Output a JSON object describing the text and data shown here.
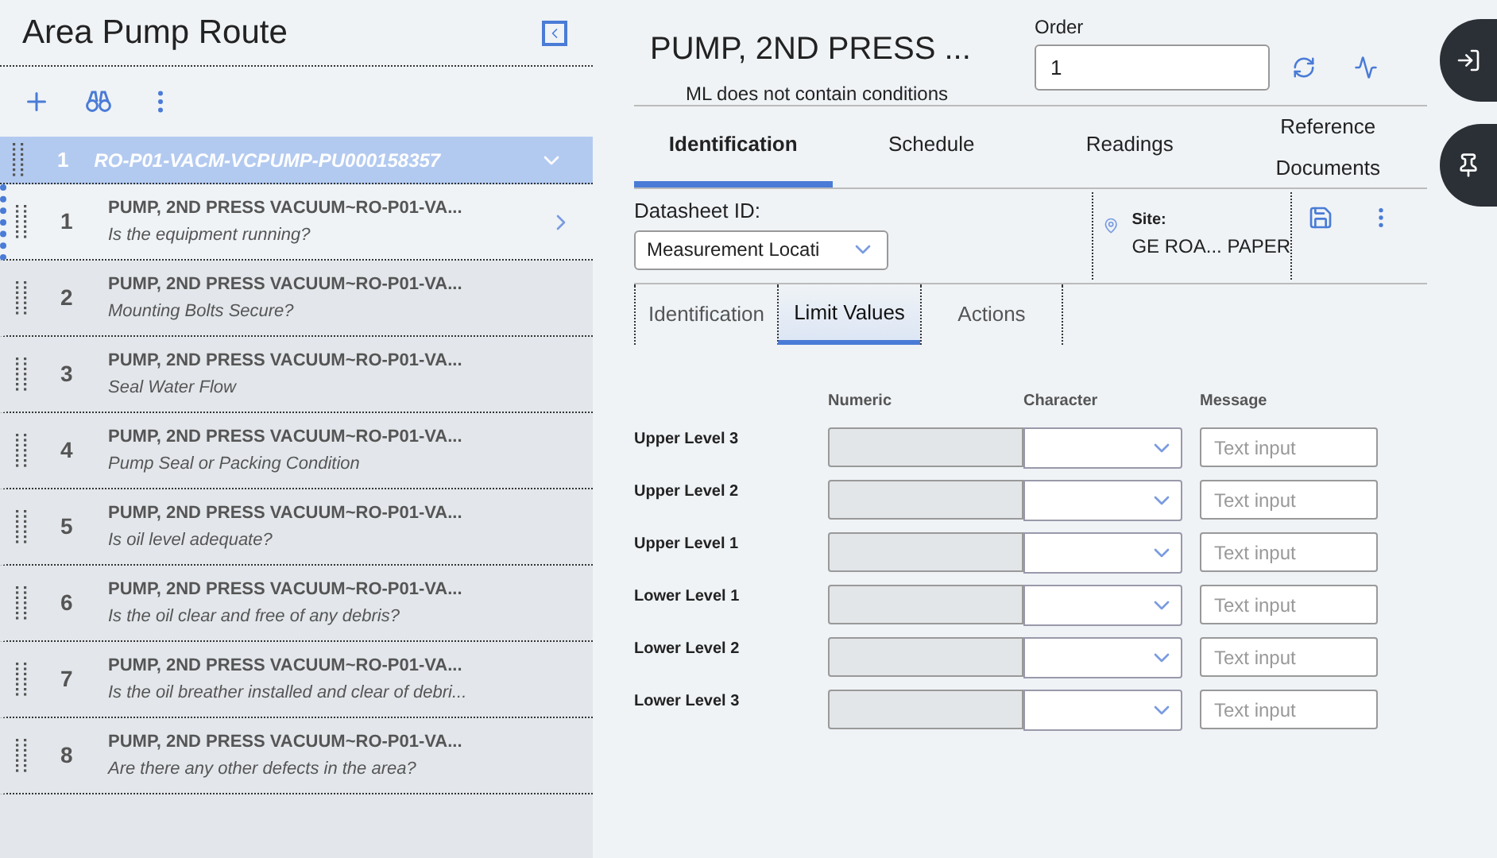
{
  "sidebar": {
    "title": "Area Pump Route",
    "group": {
      "number": "1",
      "name": "RO-P01-VACM-VCPUMP-PU000158357",
      "expanded": true
    },
    "items": [
      {
        "number": "1",
        "title": "PUMP, 2ND PRESS VACUUM~RO-P01-VA...",
        "question": "Is the equipment running?",
        "selected": true
      },
      {
        "number": "2",
        "title": "PUMP, 2ND PRESS VACUUM~RO-P01-VA...",
        "question": "Mounting Bolts Secure?",
        "selected": false
      },
      {
        "number": "3",
        "title": "PUMP, 2ND PRESS VACUUM~RO-P01-VA...",
        "question": "Seal Water Flow",
        "selected": false
      },
      {
        "number": "4",
        "title": "PUMP, 2ND PRESS VACUUM~RO-P01-VA...",
        "question": "Pump Seal or Packing Condition",
        "selected": false
      },
      {
        "number": "5",
        "title": "PUMP, 2ND PRESS VACUUM~RO-P01-VA...",
        "question": "Is oil level adequate?",
        "selected": false
      },
      {
        "number": "6",
        "title": "PUMP, 2ND PRESS VACUUM~RO-P01-VA...",
        "question": "Is the oil clear and free of any debris?",
        "selected": false
      },
      {
        "number": "7",
        "title": "PUMP, 2ND PRESS VACUUM~RO-P01-VA...",
        "question": "Is the oil breather installed and clear of debri...",
        "selected": false
      },
      {
        "number": "8",
        "title": "PUMP, 2ND PRESS VACUUM~RO-P01-VA...",
        "question": "Are there any other defects in the area?",
        "selected": false
      }
    ]
  },
  "header": {
    "title": "PUMP, 2ND PRESS ...",
    "subtitle": "ML does not contain conditions",
    "order_label": "Order",
    "order_value": "1"
  },
  "tabs": [
    {
      "label": "Identification",
      "selected": true
    },
    {
      "label": "Schedule",
      "selected": false
    },
    {
      "label": "Readings",
      "selected": false
    },
    {
      "label": "Reference Documents",
      "selected": false
    }
  ],
  "datasheet": {
    "label": "Datasheet ID:",
    "value": "Measurement Locati",
    "site_label": "Site:",
    "site_value": "GE ROA... PAPER"
  },
  "subtabs": [
    {
      "label": "Identification",
      "selected": false
    },
    {
      "label": "Limit Values",
      "selected": true
    },
    {
      "label": "Actions",
      "selected": false
    }
  ],
  "limits": {
    "columns": [
      "Numeric",
      "Character",
      "Message"
    ],
    "rows": [
      {
        "label": "Upper Level 3",
        "numeric_disabled": true,
        "placeholder": "Text input"
      },
      {
        "label": "Upper Level 2",
        "numeric_disabled": true,
        "placeholder": "Text input"
      },
      {
        "label": "Upper Level 1",
        "numeric_disabled": true,
        "placeholder": "Text input"
      },
      {
        "label": "Lower Level 1",
        "numeric_disabled": true,
        "placeholder": "Text input"
      },
      {
        "label": "Lower Level 2",
        "numeric_disabled": true,
        "placeholder": "Text input"
      },
      {
        "label": "Lower Level 3",
        "numeric_disabled": true,
        "placeholder": "Text input"
      }
    ]
  }
}
